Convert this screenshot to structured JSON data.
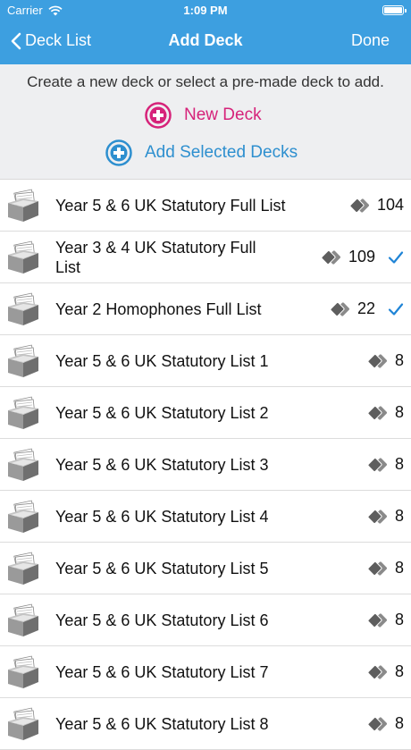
{
  "status_bar": {
    "carrier": "Carrier",
    "time": "1:09 PM"
  },
  "nav": {
    "back_label": "Deck List",
    "title": "Add Deck",
    "done_label": "Done"
  },
  "colors": {
    "nav_bg": "#3d9fe0",
    "new_deck": "#d6237a",
    "add_selected": "#2d8fcf",
    "check": "#1f84d6"
  },
  "header": {
    "instructions": "Create a new deck or select a pre-made deck to add.",
    "new_deck_label": "New Deck",
    "add_selected_label": "Add Selected Decks"
  },
  "decks": [
    {
      "title": "Year 5 & 6 UK Statutory Full List",
      "count": "104",
      "selected": false
    },
    {
      "title": "Year 3 & 4 UK Statutory Full List",
      "count": "109",
      "selected": true
    },
    {
      "title": "Year 2 Homophones Full List",
      "count": "22",
      "selected": true
    },
    {
      "title": "Year 5 & 6 UK Statutory List 1",
      "count": "8",
      "selected": false
    },
    {
      "title": "Year 5 & 6 UK Statutory List 2",
      "count": "8",
      "selected": false
    },
    {
      "title": "Year 5 & 6 UK Statutory List 3",
      "count": "8",
      "selected": false
    },
    {
      "title": "Year 5 & 6 UK Statutory List 4",
      "count": "8",
      "selected": false
    },
    {
      "title": "Year 5 & 6 UK Statutory List 5",
      "count": "8",
      "selected": false
    },
    {
      "title": "Year 5 & 6 UK Statutory List 6",
      "count": "8",
      "selected": false
    },
    {
      "title": "Year 5 & 6 UK Statutory List 7",
      "count": "8",
      "selected": false
    },
    {
      "title": "Year 5 & 6 UK Statutory List 8",
      "count": "8",
      "selected": false
    }
  ]
}
